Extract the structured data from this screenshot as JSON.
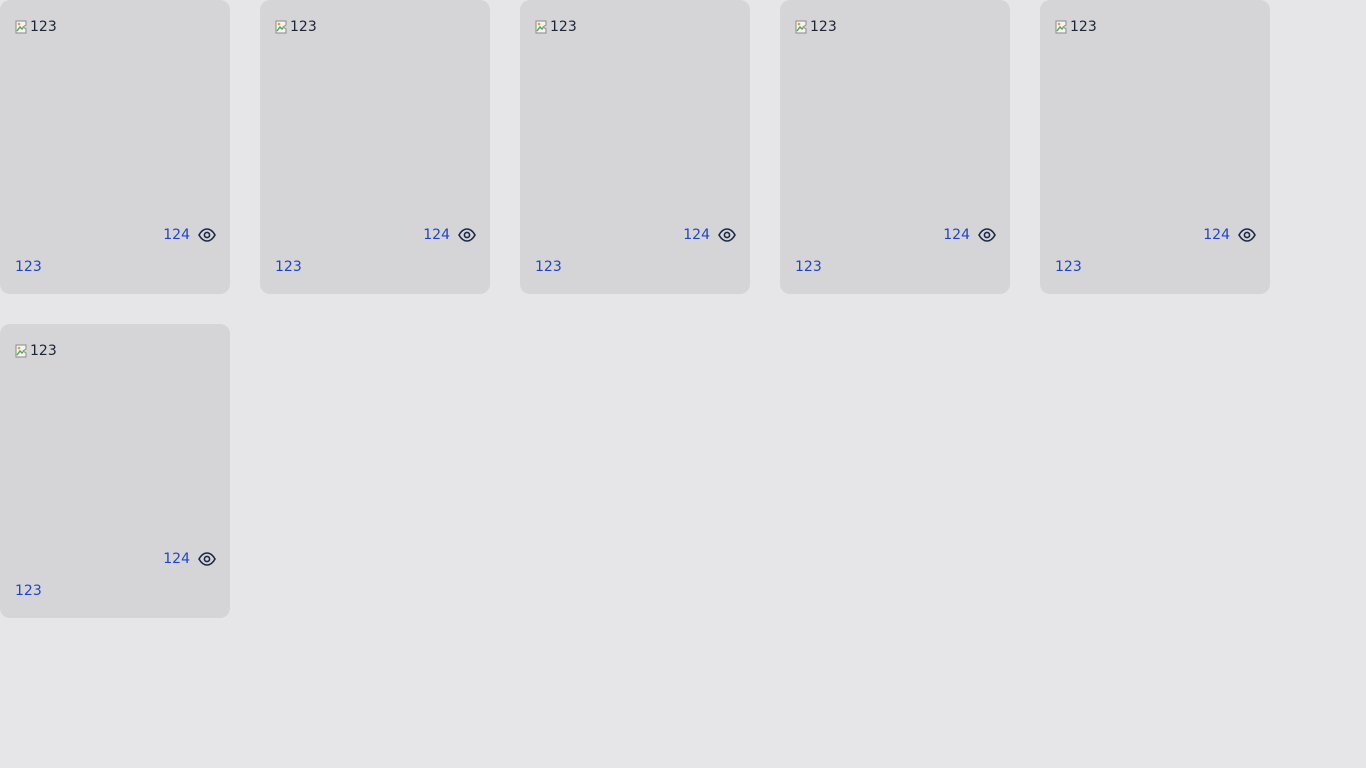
{
  "cards": [
    {
      "image_alt": "123",
      "views": "124",
      "title": "123"
    },
    {
      "image_alt": "123",
      "views": "124",
      "title": "123"
    },
    {
      "image_alt": "123",
      "views": "124",
      "title": "123"
    },
    {
      "image_alt": "123",
      "views": "124",
      "title": "123"
    },
    {
      "image_alt": "123",
      "views": "124",
      "title": "123"
    },
    {
      "image_alt": "123",
      "views": "124",
      "title": "123"
    }
  ],
  "icons": {
    "views": "eye-icon",
    "image": "broken-image-icon"
  },
  "colors": {
    "background": "#e6e6e9",
    "card": "#d5d5d8",
    "link": "#1f44c9",
    "icon": "#1b2846"
  }
}
